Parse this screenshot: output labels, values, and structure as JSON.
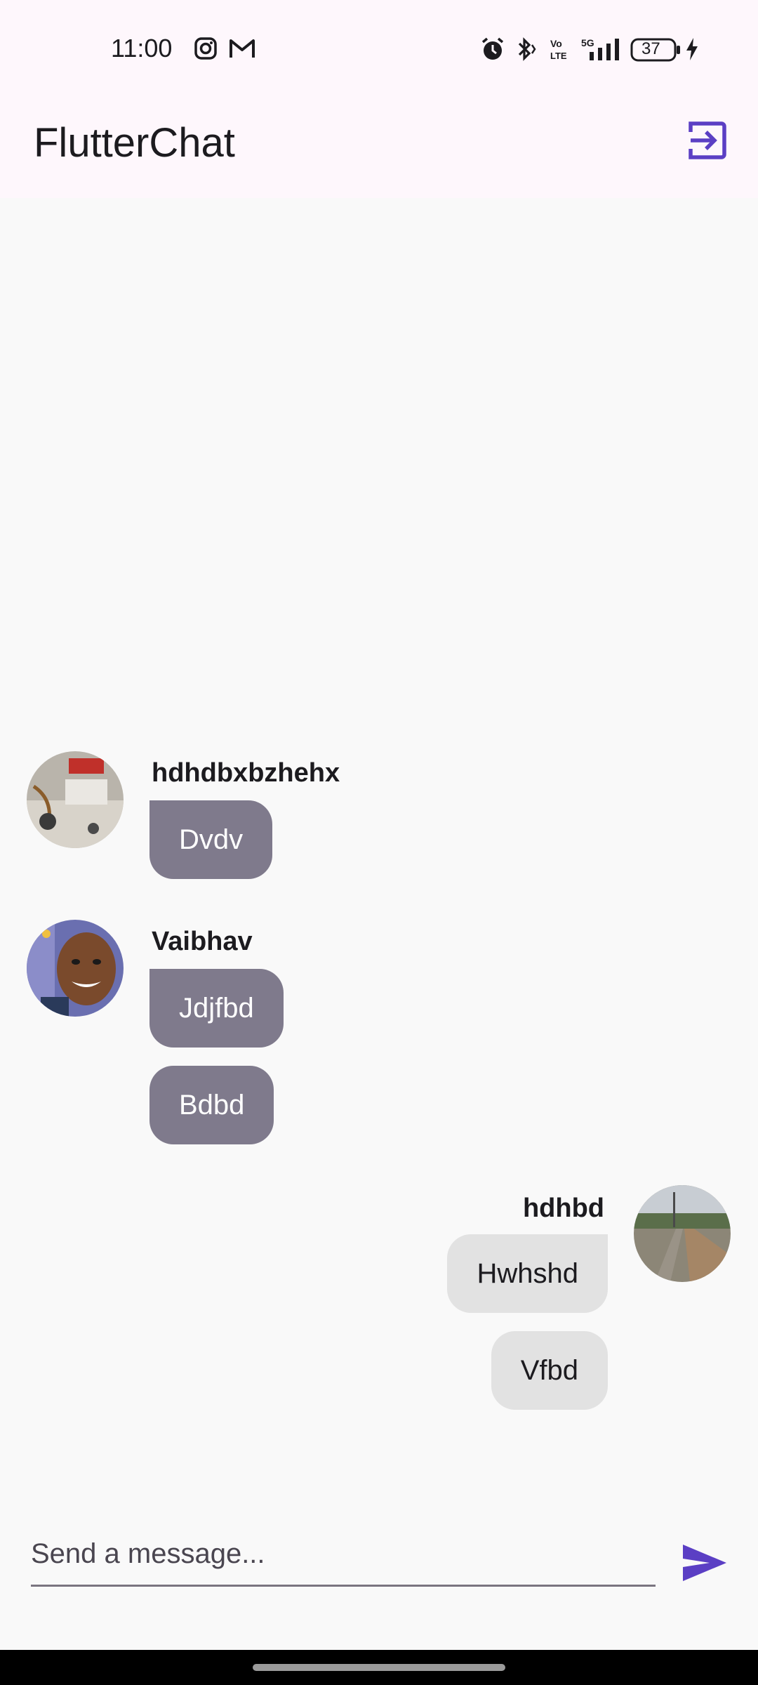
{
  "status_bar": {
    "time": "11:00",
    "battery": "37",
    "icons": [
      "instagram-icon",
      "gmail-icon",
      "alarm-icon",
      "bluetooth-icon",
      "volte-icon",
      "signal-5g-icon",
      "battery-icon",
      "charging-icon"
    ]
  },
  "app_bar": {
    "title": "FlutterChat",
    "logout_icon": "logout-icon",
    "accent": "#5b3fc4"
  },
  "messages": [
    {
      "username": "hdhdbxbzhehx",
      "bubbles": [
        "Dvdv"
      ],
      "mine": false
    },
    {
      "username": "Vaibhav",
      "bubbles": [
        "Jdjfbd",
        "Bdbd"
      ],
      "mine": false
    },
    {
      "username": "hdhbd",
      "bubbles": [
        "Hwhshd",
        "Vfbd"
      ],
      "mine": true
    }
  ],
  "composer": {
    "placeholder": "Send a message...",
    "value": "",
    "send_icon": "send-icon"
  },
  "colors": {
    "other_bubble": "#7f7a8c",
    "mine_bubble": "#e2e2e2",
    "app_bar_bg": "#fef7fc",
    "chat_bg": "#f9f9f9"
  }
}
